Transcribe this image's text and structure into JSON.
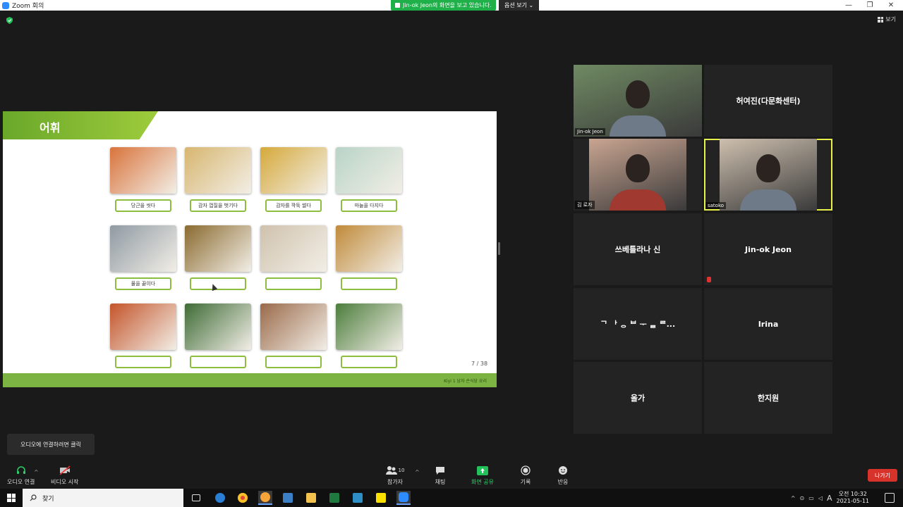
{
  "window": {
    "title": "Zoom 회의"
  },
  "share_banner": {
    "text": "Jin-ok  Jeon의 화면을 보고 있습니다.",
    "view_options": "옵션 보기 ⌄"
  },
  "view_button": "보기",
  "slide": {
    "title": "어휘",
    "page": "7 / 38",
    "footer": "Kiyi 1 남자 손식당 요리",
    "rows": [
      [
        {
          "label": "당근을 씻다",
          "photo_color": "#d9733b"
        },
        {
          "label": "감자 껍질을 벗기다",
          "photo_color": "#d7b66f"
        },
        {
          "label": "감자를 깍둑 썰다",
          "photo_color": "#d5a93a"
        },
        {
          "label": "마늘을 다지다",
          "photo_color": "#b9d4c7"
        }
      ],
      [
        {
          "label": "물을 끓이다",
          "photo_color": "#8f9aa3"
        },
        {
          "label": "",
          "photo_color": "#8a6a30"
        },
        {
          "label": "",
          "photo_color": "#cfc2ad"
        },
        {
          "label": "",
          "photo_color": "#c08a3a"
        }
      ],
      [
        {
          "label": "",
          "photo_color": "#c4542a"
        },
        {
          "label": "",
          "photo_color": "#3e6b35"
        },
        {
          "label": "",
          "photo_color": "#9a6a4a"
        },
        {
          "label": "",
          "photo_color": "#4c7d3c"
        }
      ]
    ]
  },
  "participants": [
    {
      "name": "Jin-ok Jeon",
      "has_video": true,
      "bg": "#6f8a62",
      "active": false,
      "muted": false
    },
    {
      "name": "허여진(다문화센터)",
      "has_video": false,
      "active": false,
      "muted": false
    },
    {
      "name": "김 로자",
      "has_video": true,
      "bg": "#c9a591",
      "active": false,
      "muted": false
    },
    {
      "name": "satoko",
      "has_video": true,
      "bg": "#cdbfae",
      "active": true,
      "muted": false
    },
    {
      "name": "쓰베틀라나 신",
      "has_video": false,
      "active": false,
      "muted": false
    },
    {
      "name": "Jin-ok Jeon",
      "has_video": false,
      "active": false,
      "muted": true
    },
    {
      "name": "ᄀ ᅡ ᆼ ᄇ ᅮ ᆯ ᄅ...",
      "has_video": false,
      "active": false,
      "muted": false
    },
    {
      "name": "Irina",
      "has_video": false,
      "active": false,
      "muted": false
    },
    {
      "name": "올가",
      "has_video": false,
      "active": false,
      "muted": false
    },
    {
      "name": "한지원",
      "has_video": false,
      "active": false,
      "muted": false
    }
  ],
  "tooltip": "오디오에 연결하려면 클릭",
  "toolbar": {
    "audio": "오디오 연결",
    "video": "비디오 시작",
    "participants": "참가자",
    "participant_count": "10",
    "chat": "채팅",
    "share": "화면 공유",
    "record": "기록",
    "reactions": "반응",
    "leave": "나가기"
  },
  "taskbar": {
    "search": "찾기",
    "ime": "A",
    "time": "오전 10:32",
    "date": "2021-05-11"
  }
}
